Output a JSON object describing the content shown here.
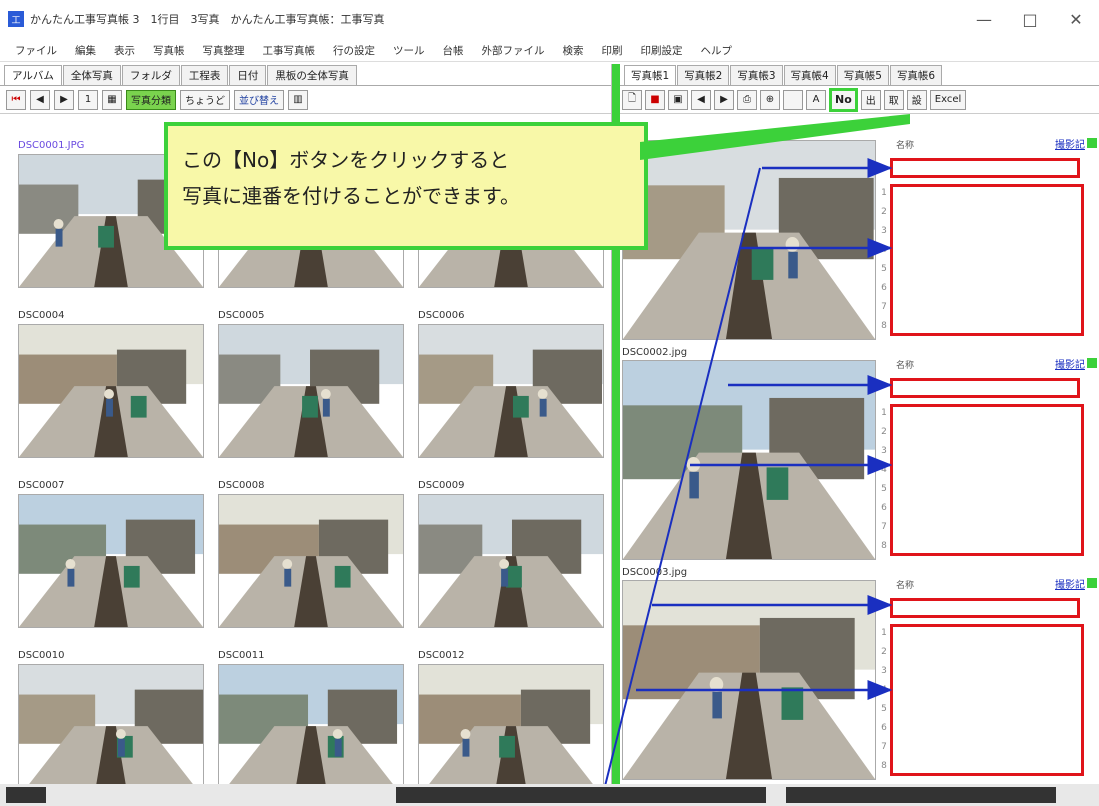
{
  "window": {
    "title": "かんたん工事写真帳 3　1行目　3写真　かんたん工事写真帳：工事写真",
    "minimize": "—",
    "maximize": "□",
    "close": "✕"
  },
  "menu": [
    "ファイル",
    "編集",
    "表示",
    "写真帳",
    "写真整理",
    "工事写真帳",
    "行の設定",
    "ツール",
    "台帳",
    "外部ファイル",
    "検索",
    "印刷",
    "印刷設定",
    "ヘルプ"
  ],
  "left_tabs": [
    "アルバム",
    "全体写真",
    "フォルダ",
    "工程表",
    "日付",
    "黒板の全体写真"
  ],
  "left_toolbar": {
    "green_btn": "写真分類",
    "filter_label": "ちょうど",
    "dropdown_value": "ちょうど",
    "sort_label": "並び替え"
  },
  "thumbnails": [
    {
      "label": "DSC0001.JPG",
      "highlight": true
    },
    {
      "label": "",
      "highlight": false
    },
    {
      "label": "",
      "highlight": false
    },
    {
      "label": "DSC0004",
      "highlight": false
    },
    {
      "label": "DSC0005",
      "highlight": false
    },
    {
      "label": "DSC0006",
      "highlight": false
    },
    {
      "label": "DSC0007",
      "highlight": false
    },
    {
      "label": "DSC0008",
      "highlight": false
    },
    {
      "label": "DSC0009",
      "highlight": false
    },
    {
      "label": "DSC0010",
      "highlight": false
    },
    {
      "label": "DSC0011",
      "highlight": false
    },
    {
      "label": "DSC0012",
      "highlight": false
    }
  ],
  "right_tabs": [
    "写真帳1",
    "写真帳2",
    "写真帳3",
    "写真帳4",
    "写真帳5",
    "写真帳6"
  ],
  "right_toolbar": {
    "no_button": "No",
    "excel_button": "Excel"
  },
  "photos": [
    {
      "label": "",
      "title_label": "名称",
      "info_link": "撮影記"
    },
    {
      "label": "DSC0002.jpg",
      "title_label": "名称",
      "info_link": "撮影記"
    },
    {
      "label": "DSC0003.jpg",
      "title_label": "名称",
      "info_link": "撮影記"
    }
  ],
  "callout": {
    "line1": "この【No】ボタンをクリックすると",
    "line2": "写真に連番を付けることができます。"
  },
  "colors": {
    "accent_green": "#3cd13a",
    "highlight_red": "#e0141a",
    "arrow_blue": "#1a2fc0",
    "callout_bg": "#f8f8a8"
  }
}
